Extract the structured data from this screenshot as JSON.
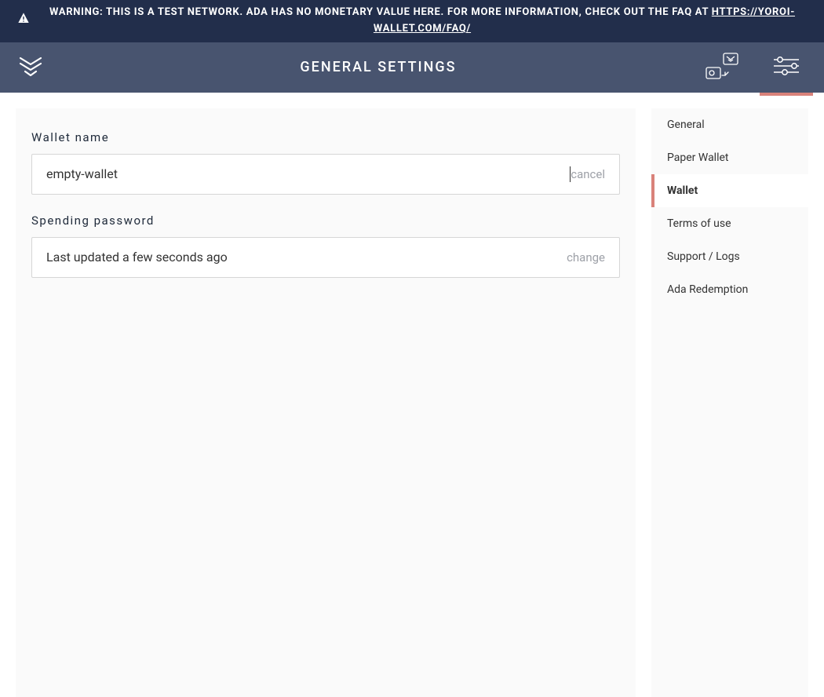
{
  "banner": {
    "text": "WARNING: THIS IS A TEST NETWORK. ADA HAS NO MONETARY VALUE HERE. FOR MORE INFORMATION, CHECK OUT THE FAQ AT ",
    "link_text": "HTTPS://YOROI-WALLET.COM/FAQ/"
  },
  "topbar": {
    "title": "GENERAL SETTINGS"
  },
  "main": {
    "wallet_name_label": "Wallet name",
    "wallet_name_value": "empty-wallet",
    "wallet_name_cancel": "cancel",
    "spending_password_label": "Spending password",
    "spending_password_status": "Last updated a few seconds ago",
    "spending_password_change": "change"
  },
  "sidebar": {
    "items": [
      {
        "label": "General",
        "active": false
      },
      {
        "label": "Paper Wallet",
        "active": false
      },
      {
        "label": "Wallet",
        "active": true
      },
      {
        "label": "Terms of use",
        "active": false
      },
      {
        "label": "Support / Logs",
        "active": false
      },
      {
        "label": "Ada Redemption",
        "active": false
      }
    ]
  },
  "colors": {
    "accent": "#d9827a",
    "header_bg": "#48546f",
    "banner_bg": "#222e4b",
    "panel_bg": "#fafafa"
  }
}
